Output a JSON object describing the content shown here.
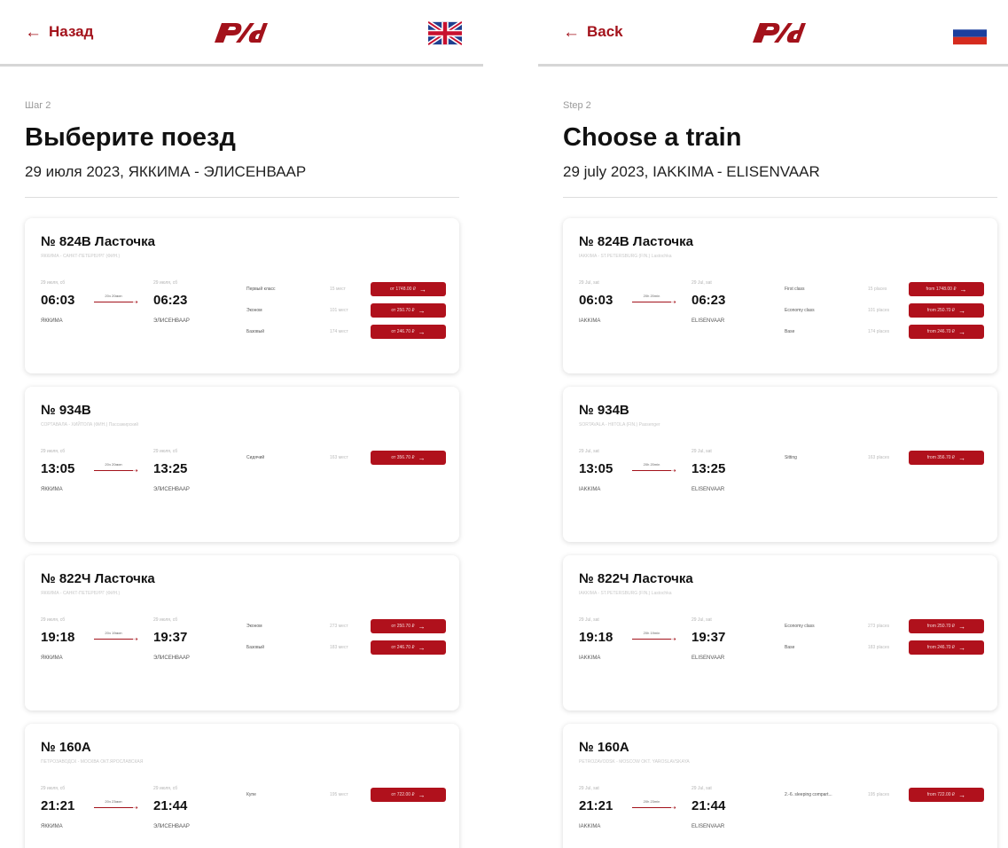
{
  "left": {
    "back_label": "Назад",
    "flag_icon": "uk-flag-icon",
    "step": "Шаг 2",
    "title": "Выберите поезд",
    "subtitle": "29 июля 2023, ЯККИМА - ЭЛИСЕНВААР",
    "trains": [
      {
        "number": "№ 824В Ласточка",
        "route": "ЯККИМА - САНКТ-ПЕТЕРБУРГ (ФИН.)",
        "dep_date": "29 июля, сб",
        "dep_time": "06:03",
        "dep_station": "ЯККИМА",
        "duration": "20ч 20мин",
        "arr_date": "29 июля, сб",
        "arr_time": "06:23",
        "arr_station": "ЭЛИСЕНВААР",
        "fares": [
          {
            "class": "Первый класс",
            "seats": "15 мест",
            "price": "от 1748.00 ₽"
          },
          {
            "class": "Эконом",
            "seats": "101 мест",
            "price": "от 250.70 ₽"
          },
          {
            "class": "Базовый",
            "seats": "174 мест",
            "price": "от 246.70 ₽"
          }
        ]
      },
      {
        "number": "№ 934В",
        "route": "СОРТАВАЛА - ХИЙТОЛА (ФИН.) Пассажирский",
        "dep_date": "29 июля, сб",
        "dep_time": "13:05",
        "dep_station": "ЯККИМА",
        "duration": "20ч 20мин",
        "arr_date": "29 июля, сб",
        "arr_time": "13:25",
        "arr_station": "ЭЛИСЕНВААР",
        "fares": [
          {
            "class": "Сидячий",
            "seats": "163 мест",
            "price": "от 356.70 ₽"
          }
        ]
      },
      {
        "number": "№ 822Ч Ласточка",
        "route": "ЯККИМА - САНКТ-ПЕТЕРБУРГ (ФИН.)",
        "dep_date": "29 июля, сб",
        "dep_time": "19:18",
        "dep_station": "ЯККИМА",
        "duration": "20ч 19мин",
        "arr_date": "29 июля, сб",
        "arr_time": "19:37",
        "arr_station": "ЭЛИСЕНВААР",
        "fares": [
          {
            "class": "Эконом",
            "seats": "273 мест",
            "price": "от 250.70 ₽"
          },
          {
            "class": "Базовый",
            "seats": "183 мест",
            "price": "от 246.70 ₽"
          }
        ]
      },
      {
        "number": "№ 160А",
        "route": "ПЕТРОЗАВОДСК - МОСКВА ОКТ.ЯРОСЛАВСКАЯ",
        "dep_date": "29 июля, сб",
        "dep_time": "21:21",
        "dep_station": "ЯККИМА",
        "duration": "20ч 23мин",
        "arr_date": "29 июля, сб",
        "arr_time": "21:44",
        "arr_station": "ЭЛИСЕНВААР",
        "fares": [
          {
            "class": "Купе",
            "seats": "195 мест",
            "price": "от 722.00 ₽"
          }
        ]
      }
    ]
  },
  "right": {
    "back_label": "Back",
    "flag_icon": "russia-flag-icon",
    "step": "Step 2",
    "title": "Choose a train",
    "subtitle": "29 july 2023, IAKKIMA - ELISENVAAR",
    "trains": [
      {
        "number": "№ 824В Ласточка",
        "route": "IAKKIMA - ST.PETERSBURG (FIN.) Lastochka",
        "dep_date": "29 Jul, sat",
        "dep_time": "06:03",
        "dep_station": "IAKKIMA",
        "duration": "20h 20min",
        "arr_date": "29 Jul, sat",
        "arr_time": "06:23",
        "arr_station": "ELISENVAAR",
        "fares": [
          {
            "class": "First class",
            "seats": "15 places",
            "price": "from 1748.00 ₽"
          },
          {
            "class": "Economy class",
            "seats": "101 places",
            "price": "from 250.70 ₽"
          },
          {
            "class": "Base",
            "seats": "174 places",
            "price": "from 246.70 ₽"
          }
        ]
      },
      {
        "number": "№ 934В",
        "route": "SORTAVALA - HIITOLA (FIN.) Passenger",
        "dep_date": "29 Jul, sat",
        "dep_time": "13:05",
        "dep_station": "IAKKIMA",
        "duration": "20h 20min",
        "arr_date": "29 Jul, sat",
        "arr_time": "13:25",
        "arr_station": "ELISENVAAR",
        "fares": [
          {
            "class": "Sitting",
            "seats": "163 places",
            "price": "from 356.70 ₽"
          }
        ]
      },
      {
        "number": "№ 822Ч Ласточка",
        "route": "IAKKIMA - ST.PETERSBURG (FIN.) Lastochka",
        "dep_date": "29 Jul, sat",
        "dep_time": "19:18",
        "dep_station": "IAKKIMA",
        "duration": "20h 19min",
        "arr_date": "29 Jul, sat",
        "arr_time": "19:37",
        "arr_station": "ELISENVAAR",
        "fares": [
          {
            "class": "Economy class",
            "seats": "273 places",
            "price": "from 250.70 ₽"
          },
          {
            "class": "Base",
            "seats": "183 places",
            "price": "from 246.70 ₽"
          }
        ]
      },
      {
        "number": "№ 160А",
        "route": "PETROZAVODSK - MOSCOW OKT. YAROSLAVSKAYA",
        "dep_date": "29 Jul, sat",
        "dep_time": "21:21",
        "dep_station": "IAKKIMA",
        "duration": "20h 23min",
        "arr_date": "29 Jul, sat",
        "arr_time": "21:44",
        "arr_station": "ELISENVAAR",
        "fares": [
          {
            "class": "2.-6. sleeping compart...",
            "seats": "195 places",
            "price": "from 722.00 ₽"
          }
        ]
      }
    ]
  },
  "colors": {
    "accent": "#a3121b",
    "button": "#b0111c",
    "separator": "#d6d6d6"
  }
}
